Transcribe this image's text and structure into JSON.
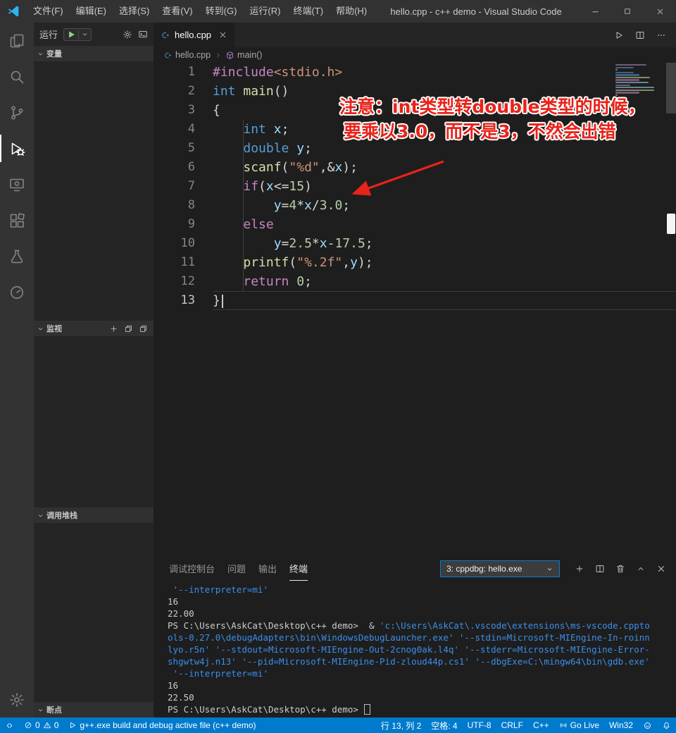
{
  "colors": {
    "accent": "#007acc",
    "annotation": "#e8231a"
  },
  "title_bar": {
    "menus": [
      "文件(F)",
      "编辑(E)",
      "选择(S)",
      "查看(V)",
      "转到(G)",
      "运行(R)",
      "终端(T)",
      "帮助(H)"
    ],
    "title": "hello.cpp - c++ demo - Visual Studio Code"
  },
  "activity_bar": {
    "items": [
      {
        "icon": "files"
      },
      {
        "icon": "search"
      },
      {
        "icon": "source-control"
      },
      {
        "icon": "run-debug",
        "active": true
      },
      {
        "icon": "remote-explorer"
      },
      {
        "icon": "extensions"
      },
      {
        "icon": "test"
      },
      {
        "icon": "circle-arrow"
      }
    ],
    "bottom_items": [
      {
        "icon": "gear"
      }
    ]
  },
  "sidebar": {
    "run_toolbar": {
      "label": "运行"
    },
    "sections": [
      {
        "label": "变量"
      },
      {
        "label": "监视"
      },
      {
        "label": "调用堆栈"
      },
      {
        "label": "断点"
      }
    ]
  },
  "editor": {
    "tab": {
      "label": "hello.cpp"
    },
    "breadcrumb": {
      "file": "hello.cpp",
      "symbol": "main()"
    },
    "code": {
      "token_colors": {
        "pre": "#C586C0",
        "str": "#CE9178",
        "kw": "#569CD6",
        "fn": "#DCDCAA",
        "var": "#9CDCFE",
        "num": "#B5CEA8",
        "pun": "#D4D4D4"
      },
      "current_line": 13,
      "cursor_position": {
        "line": 13,
        "col": 2
      },
      "lines": [
        [
          [
            "#include",
            "pre"
          ],
          [
            "<stdio.h>",
            "str"
          ]
        ],
        [
          [
            "int",
            "kw"
          ],
          [
            " ",
            "pun"
          ],
          [
            "main",
            "fn"
          ],
          [
            "()",
            "pun"
          ]
        ],
        [
          [
            "{",
            "pun"
          ]
        ],
        [
          [
            "    ",
            "pun"
          ],
          [
            "int",
            "kw"
          ],
          [
            " ",
            "pun"
          ],
          [
            "x",
            "var"
          ],
          [
            ";",
            "pun"
          ]
        ],
        [
          [
            "    ",
            "pun"
          ],
          [
            "double",
            "kw"
          ],
          [
            " ",
            "pun"
          ],
          [
            "y",
            "var"
          ],
          [
            ";",
            "pun"
          ]
        ],
        [
          [
            "    ",
            "pun"
          ],
          [
            "scanf",
            "fn"
          ],
          [
            "(",
            "pun"
          ],
          [
            "\"%d\"",
            "str"
          ],
          [
            ",&",
            "pun"
          ],
          [
            "x",
            "var"
          ],
          [
            ");",
            "pun"
          ]
        ],
        [
          [
            "    ",
            "pun"
          ],
          [
            "if",
            "pre"
          ],
          [
            "(",
            "pun"
          ],
          [
            "x",
            "var"
          ],
          [
            "<=",
            "pun"
          ],
          [
            "15",
            "num"
          ],
          [
            ")",
            "pun"
          ]
        ],
        [
          [
            "        ",
            "pun"
          ],
          [
            "y",
            "var"
          ],
          [
            "=",
            "pun"
          ],
          [
            "4",
            "num"
          ],
          [
            "*",
            "pun"
          ],
          [
            "x",
            "var"
          ],
          [
            "/",
            "pun"
          ],
          [
            "3.0",
            "num"
          ],
          [
            ";",
            "pun"
          ]
        ],
        [
          [
            "    ",
            "pun"
          ],
          [
            "else",
            "pre"
          ]
        ],
        [
          [
            "        ",
            "pun"
          ],
          [
            "y",
            "var"
          ],
          [
            "=",
            "pun"
          ],
          [
            "2.5",
            "num"
          ],
          [
            "*",
            "pun"
          ],
          [
            "x",
            "var"
          ],
          [
            "-",
            "pun"
          ],
          [
            "17.5",
            "num"
          ],
          [
            ";",
            "pun"
          ]
        ],
        [
          [
            "    ",
            "pun"
          ],
          [
            "printf",
            "fn"
          ],
          [
            "(",
            "pun"
          ],
          [
            "\"%.2f\"",
            "str"
          ],
          [
            ",",
            "pun"
          ],
          [
            "y",
            "var"
          ],
          [
            ");",
            "pun"
          ]
        ],
        [
          [
            "    ",
            "pun"
          ],
          [
            "return",
            "pre"
          ],
          [
            " ",
            "pun"
          ],
          [
            "0",
            "num"
          ],
          [
            ";",
            "pun"
          ]
        ],
        [
          [
            "}",
            "pun"
          ]
        ]
      ]
    },
    "annotation": {
      "line1": "注意：int类型转double类型的时候，",
      "line2": "要乘以3.0，而不是3，不然会出错",
      "color": "#e8231a"
    }
  },
  "panel": {
    "tabs": [
      {
        "label": "调试控制台",
        "active": false
      },
      {
        "label": "问题",
        "active": false
      },
      {
        "label": "输出",
        "active": false
      },
      {
        "label": "终端",
        "active": true
      }
    ],
    "terminal_selector": "3: cppdbg: hello.exe",
    "terminal": {
      "colors": {
        "fg": "#cccccc",
        "blue": "#3b8eea"
      },
      "lines": [
        [
          [
            " '--interpreter=mi' ",
            "blue"
          ]
        ],
        [
          [
            "16",
            "fg"
          ]
        ],
        [
          [
            "22.00",
            "fg"
          ]
        ],
        [
          [
            "PS C:\\Users\\AskCat\\Desktop\\c++ demo>  & ",
            "fg"
          ],
          [
            "'c:\\Users\\AskCat\\.vscode\\extensions\\ms-vscode.cppto",
            "blue"
          ]
        ],
        [
          [
            "ols-0.27.0\\debugAdapters\\bin\\WindowsDebugLauncher.exe' '--stdin=Microsoft-MIEngine-In-roinn",
            "blue"
          ]
        ],
        [
          [
            "lyo.r5n' '--stdout=Microsoft-MIEngine-Out-2cnog0ak.l4q' '--stderr=Microsoft-MIEngine-Error-",
            "blue"
          ]
        ],
        [
          [
            "shgwtw4j.n13' '--pid=Microsoft-MIEngine-Pid-zloud44p.cs1' '--dbgExe=C:\\mingw64\\bin\\gdb.exe'",
            "blue"
          ]
        ],
        [
          [
            " '--interpreter=mi'",
            "blue"
          ]
        ],
        [
          [
            "16",
            "fg"
          ]
        ],
        [
          [
            "22.50",
            "fg"
          ]
        ],
        [
          [
            "PS C:\\Users\\AskCat\\Desktop\\c++ demo> ",
            "fg"
          ],
          [
            "",
            "cursor"
          ]
        ]
      ]
    }
  },
  "status_bar": {
    "errors": "0",
    "warnings": "0",
    "task": "g++.exe build and debug active file (c++ demo)",
    "cursor_position": "行 13, 列 2",
    "indent": "空格: 4",
    "encoding": "UTF-8",
    "eol": "CRLF",
    "language": "C++",
    "go_live": "Go Live",
    "platform": "Win32"
  }
}
